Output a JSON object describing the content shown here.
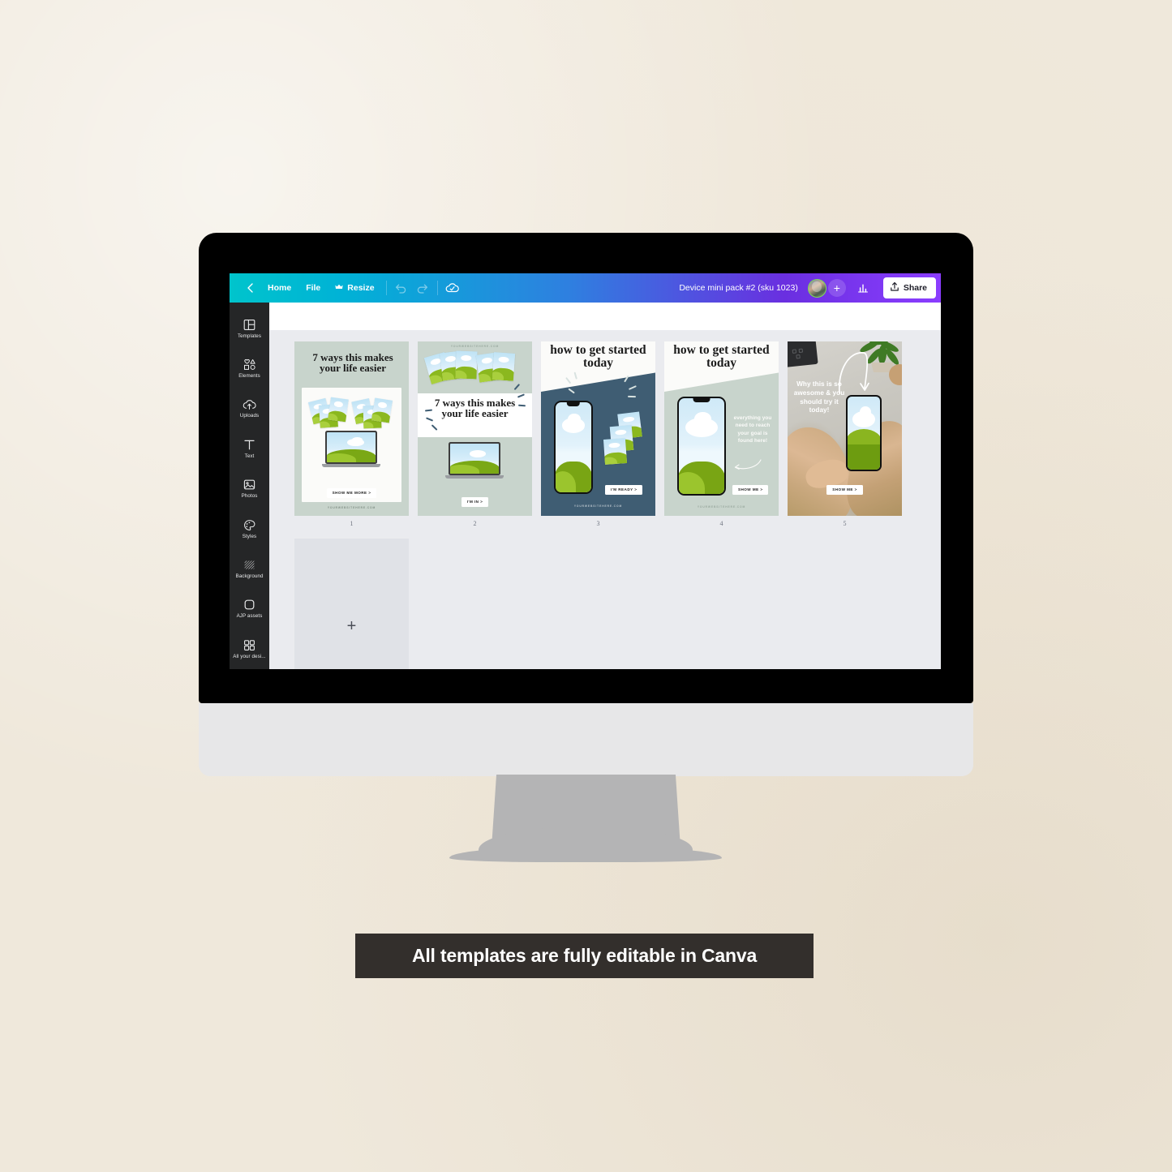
{
  "background": {
    "color": "#efe8db"
  },
  "caption": {
    "text": "All templates are fully editable in Canva",
    "bg": "#332f2c"
  },
  "app": {
    "topbar": {
      "back_icon": "chevron-left-icon",
      "home_label": "Home",
      "file_label": "File",
      "resize_label": "Resize",
      "resize_icon": "crown-icon",
      "undo_icon": "undo-icon",
      "redo_icon": "redo-icon",
      "cloud_icon": "cloud-check-icon",
      "doc_title": "Device mini pack #2 (sku 1023)",
      "avatar_icon": "user-avatar",
      "add_collaborator_label": "+",
      "insights_icon": "bar-chart-icon",
      "share_label": "Share",
      "share_icon": "upload-icon",
      "gradient_start": "#00c4cc",
      "gradient_end": "#8b3dff"
    },
    "sidebar": {
      "bg": "#252627",
      "items": [
        {
          "label": "Templates",
          "icon": "templates-icon"
        },
        {
          "label": "Elements",
          "icon": "elements-icon"
        },
        {
          "label": "Uploads",
          "icon": "upload-cloud-icon"
        },
        {
          "label": "Text",
          "icon": "text-icon"
        },
        {
          "label": "Photos",
          "icon": "photo-icon"
        },
        {
          "label": "Styles",
          "icon": "palette-icon"
        },
        {
          "label": "Background",
          "icon": "background-icon"
        },
        {
          "label": "AJP assets",
          "icon": "rounded-square-icon"
        },
        {
          "label": "All your desi...",
          "icon": "grid-icon"
        }
      ]
    },
    "canvas": {
      "bg": "#eaebef",
      "add_page_label": "+",
      "pages": [
        {
          "number": "1",
          "bg": "#c8d4cc",
          "headline": "7 ways this makes your life easier",
          "cta": "SHOW ME MORE >",
          "website": "YOURWEBSITEHERE.COM",
          "device": "laptop"
        },
        {
          "number": "2",
          "bg": "#c8d4cc",
          "headline": "7 ways this makes your life easier",
          "cta": "I'M IN >",
          "website": "YOURWEBSITEHERE.COM",
          "device": "laptop"
        },
        {
          "number": "3",
          "bg": "#3f5d73",
          "headline": "how to get started today",
          "cta": "I'M READY >",
          "website": "YOURWEBSITEHERE.COM",
          "device": "phone"
        },
        {
          "number": "4",
          "bg": "#c8d4cc",
          "headline": "how to get started today",
          "body": "everything you need to reach your goal is found here!",
          "cta": "SHOW ME >",
          "website": "YOURWEBSITEHERE.COM",
          "device": "phone"
        },
        {
          "number": "5",
          "bg": "#b9b6ae",
          "headline": "Why this is so awesome & you should try it today!",
          "cta": "SHOW ME >",
          "device": "photo-hands-phone"
        }
      ]
    }
  }
}
